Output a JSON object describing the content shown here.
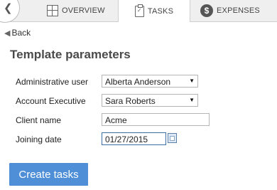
{
  "tabs": [
    {
      "label": "OVERVIEW",
      "icon": "grid-icon"
    },
    {
      "label": "TASKS",
      "icon": "clipboard-icon",
      "active": true
    },
    {
      "label": "EXPENSES",
      "icon": "dollar-icon"
    }
  ],
  "back": {
    "label": "Back"
  },
  "page_title": "Template parameters",
  "form": {
    "admin_user": {
      "label": "Administrative user",
      "value": "Alberta Anderson"
    },
    "account_exec": {
      "label": "Account Executive",
      "value": "Sara Roberts"
    },
    "client_name": {
      "label": "Client name",
      "value": "Acme"
    },
    "joining_date": {
      "label": "Joining date",
      "value": "01/27/2015"
    }
  },
  "create_button": {
    "label": "Create tasks"
  },
  "colors": {
    "accent": "#4e8fd7",
    "tabbar": "#efefef"
  }
}
